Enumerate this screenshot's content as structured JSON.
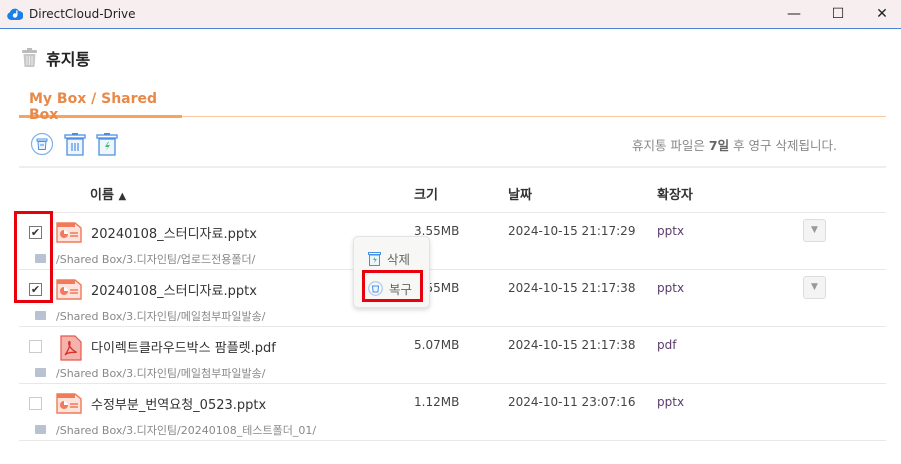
{
  "window": {
    "title": "DirectCloud-Drive",
    "controls": [
      "minimize",
      "maximize",
      "close"
    ]
  },
  "page": {
    "title": "휴지통"
  },
  "tabs": [
    {
      "label": "My Box / Shared Box",
      "active": true
    }
  ],
  "toolbar": {
    "icons": [
      "restore-icon",
      "delete-icon",
      "empty-trash-icon"
    ]
  },
  "notice": {
    "before": "휴지통 파일은 ",
    "days": "7일",
    "after": " 후 영구 삭제됩니다."
  },
  "columns": {
    "name": "이름",
    "sort": "▲",
    "size": "크기",
    "date": "날짜",
    "ext": "확장자"
  },
  "rows": [
    {
      "checked": true,
      "type": "pptx",
      "name": "20240108_스터디자료.pptx",
      "path": "/Shared Box/3.디자인팀/업로드전용폴더/",
      "size": "3.55MB",
      "date": "2024-10-15 21:17:29",
      "ext": "pptx"
    },
    {
      "checked": true,
      "type": "pptx",
      "name": "20240108_스터디자료.pptx",
      "path": "/Shared Box/3.디자인팀/메일첨부파일발송/",
      "size": "3.55MB",
      "date": "2024-10-15 21:17:38",
      "ext": "pptx"
    },
    {
      "checked": false,
      "type": "pdf",
      "name": "다이렉트클라우드박스 팜플렛.pdf",
      "path": "/Shared Box/3.디자인팀/메일첨부파일발송/",
      "size": "5.07MB",
      "date": "2024-10-15 21:17:38",
      "ext": "pdf"
    },
    {
      "checked": false,
      "type": "pptx",
      "name": "수정부분_번역요청_0523.pptx",
      "path": "/Shared Box/3.디자인팀/20240108_테스트폴더_01/",
      "size": "1.12MB",
      "date": "2024-10-11 23:07:16",
      "ext": "pptx"
    }
  ],
  "context_menu": {
    "delete": "삭제",
    "restore": "복구"
  },
  "colors": {
    "accent": "#f7a45c",
    "tab_text": "#e8894a",
    "highlight": "#e8000c",
    "icon_blue": "#4a90e2"
  }
}
